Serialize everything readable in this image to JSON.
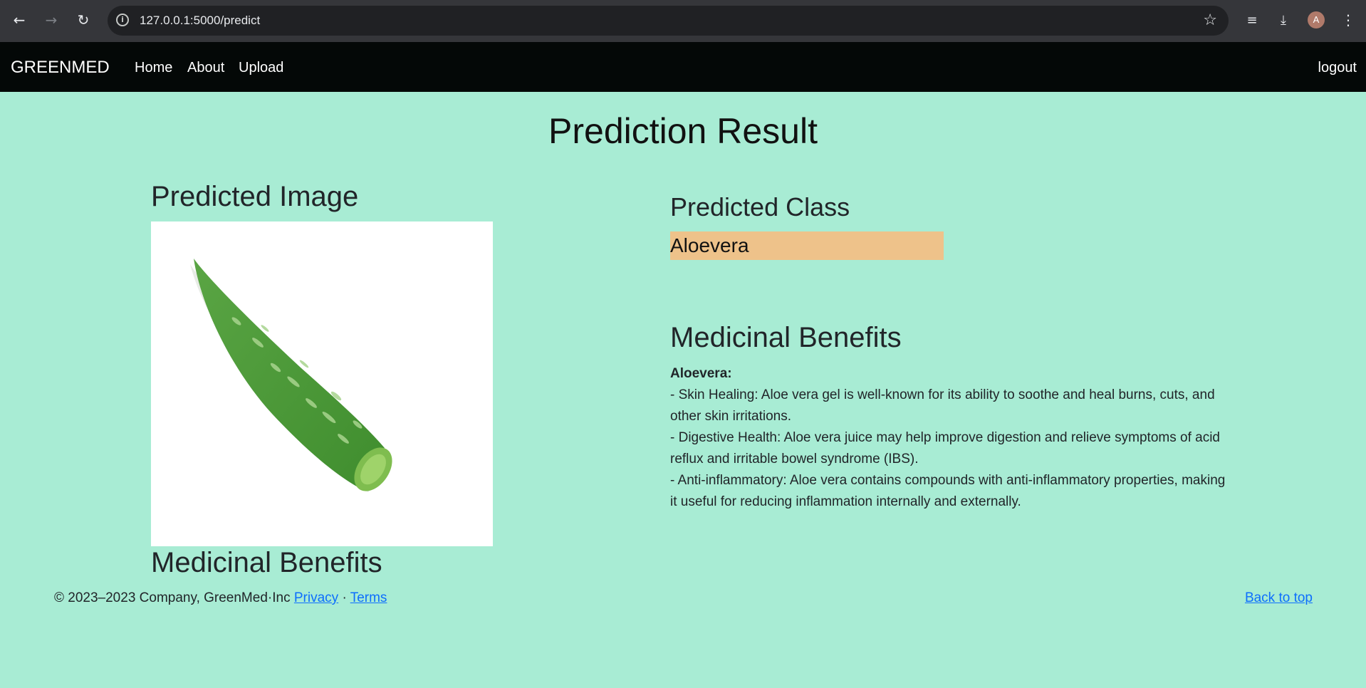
{
  "browser": {
    "url": "127.0.0.1:5000/predict",
    "avatar_letter": "A"
  },
  "nav": {
    "brand": "GREENMED",
    "links": [
      "Home",
      "About",
      "Upload"
    ],
    "logout": "logout"
  },
  "main": {
    "title": "Prediction Result",
    "predicted_image_heading": "Predicted Image",
    "left_benefits_heading": "Medicinal Benefits",
    "predicted_class_heading": "Predicted Class",
    "predicted_class": "Aloevera",
    "benefits_heading": "Medicinal Benefits",
    "benefits_name": "Aloevera:",
    "benefits": [
      "- Skin Healing: Aloe vera gel is well-known for its ability to soothe and heal burns, cuts, and other skin irritations.",
      "- Digestive Health: Aloe vera juice may help improve digestion and relieve symptoms of acid reflux and irritable bowel syndrome (IBS).",
      "- Anti-inflammatory: Aloe vera contains compounds with anti-inflammatory properties, making it useful for reducing inflammation internally and externally."
    ]
  },
  "footer": {
    "copyright": "© 2023–2023 Company, GreenMed·Inc",
    "privacy": "Privacy",
    "separator": "·",
    "terms": "Terms",
    "back_to_top": "Back to top"
  },
  "colors": {
    "page_bg": "#a8ecd4",
    "navbar_bg": "#040807",
    "badge_bg": "#eec28a",
    "link": "#0d6efd"
  }
}
